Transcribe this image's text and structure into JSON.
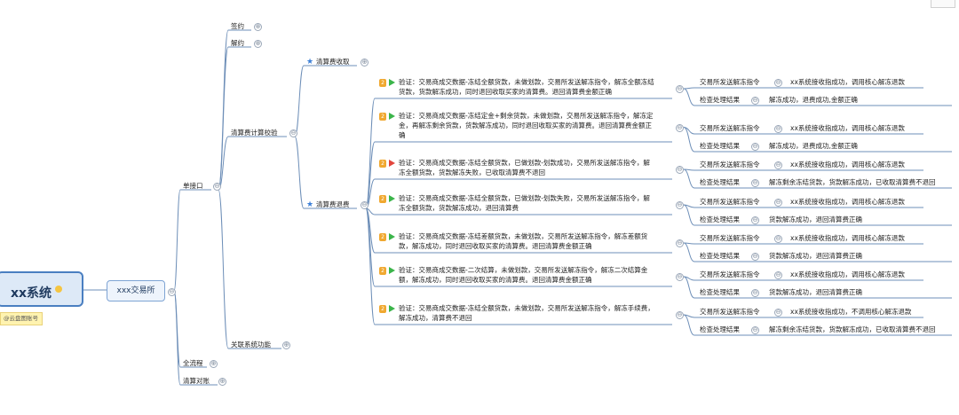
{
  "root": {
    "label": "xx系统",
    "note": "@云盘图账号"
  },
  "level1": {
    "label": "xxx交易所"
  },
  "branches": {
    "single": "单接口",
    "full": "全流程",
    "reconcile": "清算对账",
    "sign": "签约",
    "unsign": "解约",
    "fee_check": "清算费计算校验",
    "related": "关联系统功能",
    "fee_collect": "清算费收取",
    "fee_refund": "清算费退费"
  },
  "icons": {
    "expand": "⊕",
    "collapse": "⊖",
    "star": "★"
  },
  "cases": [
    {
      "priority": "2",
      "flag": "green",
      "lines": [
        "验证：交易商成交数据-冻结全额货款，未做划款，交易所发送解冻指令，解冻全额冻结",
        "货款，货款解冻成功，同时退回收取买家的清算费。退回清算费金额正确"
      ],
      "step1": "交易所发送解冻指令",
      "result1": "xx系统接收指成功，调用核心解冻退款",
      "step2": "检查处理结果",
      "result2": "解冻成功，退费成功,金额正确"
    },
    {
      "priority": "2",
      "flag": "green",
      "lines": [
        "验证：交易商成交数据-冻结定金+剩余货款，未做划款，交易所发送解冻指令，解冻定",
        "金，再解冻剩余货款，货款解冻成功，同时退回收取买家的清算费。退回清算费金额正",
        "确"
      ],
      "step1": "交易所发送解冻指令",
      "result1": "xx系统接收指成功，调用核心解冻退款",
      "step2": "检查处理结果",
      "result2": "解冻成功，退费成功,金额正确"
    },
    {
      "priority": "2",
      "flag": "red",
      "lines": [
        "验证：交易商成交数据-冻结全额货款，已做划款-划款成功，交易所发送解冻指令，解",
        "冻全额货款，货款解冻失败，已收取清算费不退回"
      ],
      "step1": "交易所发送解冻指令",
      "result1": "xx系统接收指成功，调用核心解冻退款",
      "step2": "检查处理结果",
      "result2": "解冻剩余冻结货款，货款解冻成功，已收取清算费不退回"
    },
    {
      "priority": "2",
      "flag": "green",
      "lines": [
        "验证：交易商成交数据-冻结全额货款，已做划款-划款失败，交易所发送解冻指令，解",
        "冻全额货款，货款解冻成功，退回清算费"
      ],
      "step1": "交易所发送解冻指令",
      "result1": "xx系统接收指成功，调用核心解冻退款",
      "step2": "检查处理结果",
      "result2": "货款解冻成功，退回清算费正确"
    },
    {
      "priority": "2",
      "flag": "green",
      "lines": [
        "验证：交易商成交数据-冻结差额货款，未做划款，交易所发送解冻指令，解冻差额货",
        "款，解冻成功，同时退回收取买家的清算费。退回清算费金额正确"
      ],
      "step1": "交易所发送解冻指令",
      "result1": "xx系统接收指成功，调用核心解冻退款",
      "step2": "检查处理结果",
      "result2": "货款解冻成功，退回清算费正确"
    },
    {
      "priority": "2",
      "flag": "green",
      "lines": [
        "验证：交易商成交数据-二次结算，未做划款，交易所发送解冻指令，解冻二次结算金",
        "额，解冻成功，同时退回收取买家的清算费。退回清算费金额正确"
      ],
      "step1": "交易所发送解冻指令",
      "result1": "xx系统接收指成功，调用核心解冻退款",
      "step2": "检查处理结果",
      "result2": "货款解冻成功，退回清算费正确"
    },
    {
      "priority": "2",
      "flag": "green",
      "lines": [
        "验证：交易商成交数据-冻结全额货款，未做划款，交易所发送解冻指令，解冻手续费，",
        "解冻成功，清算费不退回"
      ],
      "step1": "交易所发送解冻指令",
      "result1": "xx系统接收指成功，不调用核心解冻退款",
      "step2": "检查处理结果",
      "result2": "解冻剩余冻结货款，货款解冻成功，已收取清算费不退回"
    }
  ],
  "colors": {
    "line": "#6e8fb8",
    "root_border": "#4a7fc1",
    "flag_green": "#3bb54a",
    "flag_red": "#e2453c",
    "priority": "#f0a830"
  }
}
